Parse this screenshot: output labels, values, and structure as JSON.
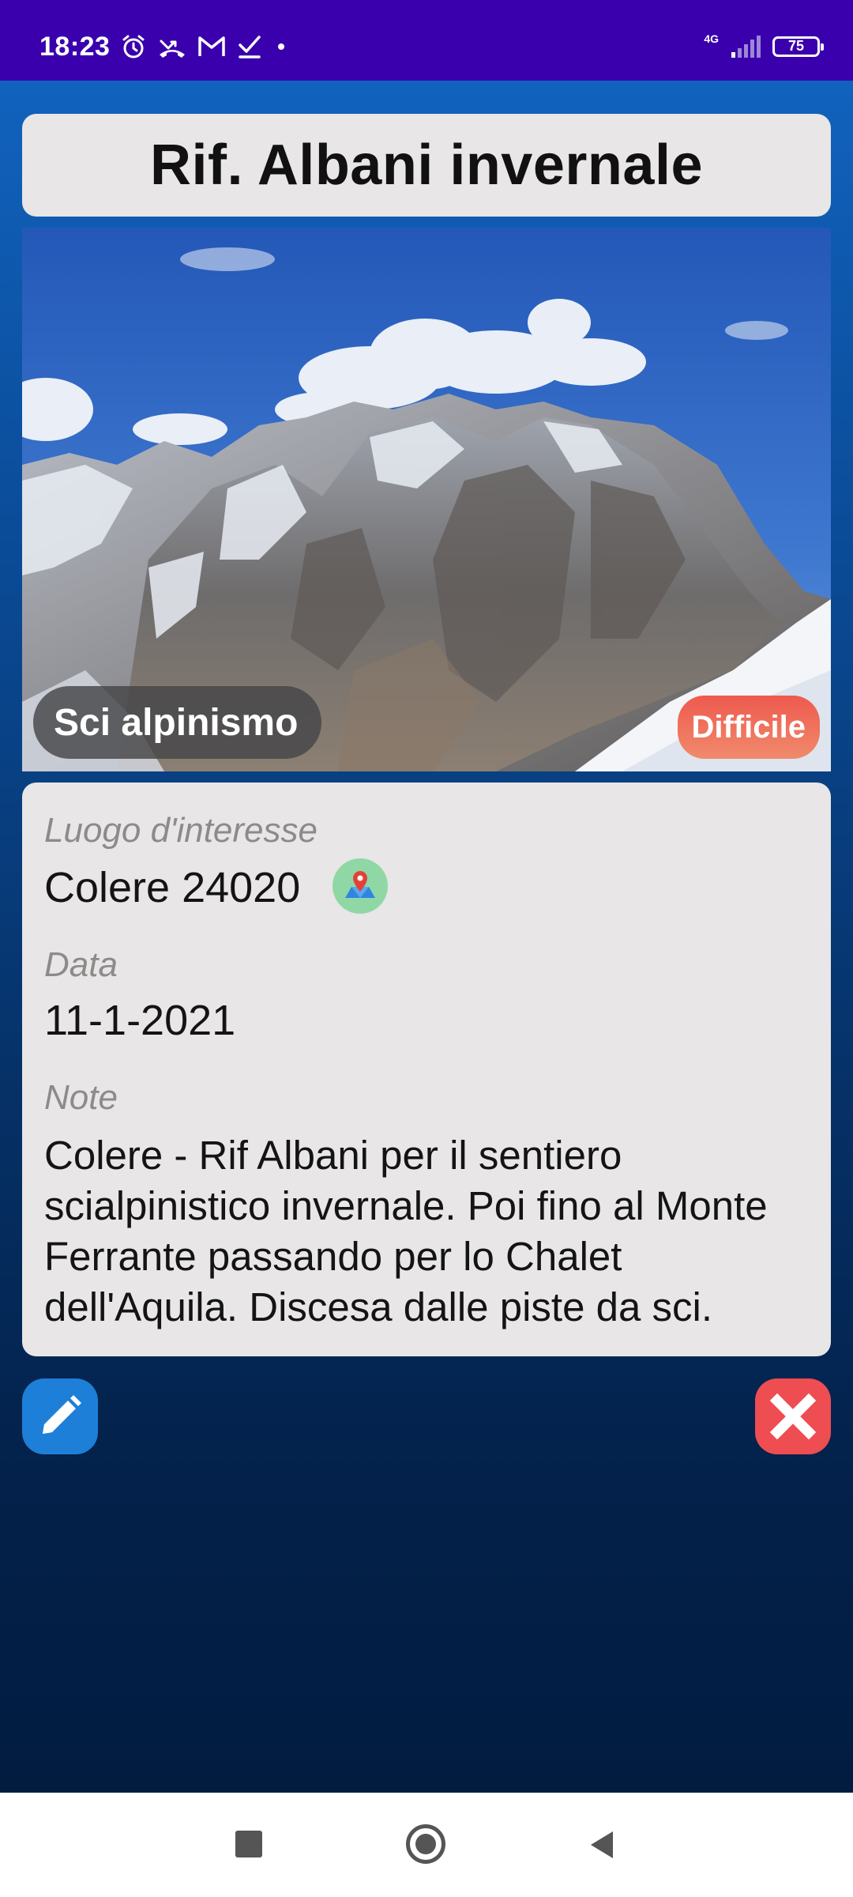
{
  "status_bar": {
    "time": "18:23",
    "network": "4G",
    "battery": "75",
    "left_icons": [
      "alarm-icon",
      "missed-call-icon",
      "gmail-icon",
      "task-done-icon",
      "dot-icon"
    ]
  },
  "excursion": {
    "title": "Rif. Albani invernale",
    "category": "Sci alpinismo",
    "difficulty": "Difficile"
  },
  "details": {
    "location_label": "Luogo d'interesse",
    "location_value": "Colere 24020",
    "date_label": "Data",
    "date_value": "11-1-2021",
    "notes_label": "Note",
    "notes_value": "Colere - Rif Albani per il sentiero scialpinistico invernale. Poi fino al Monte Ferrante passando per lo Chalet dell'Aquila. Discesa dalle piste da sci."
  },
  "actions": {
    "edit_icon": "pencil-icon",
    "delete_icon": "close-icon"
  },
  "colors": {
    "status_bar": "#3a00ad",
    "card_bg": "#e8e6e6",
    "edit_button": "#1d7fd8",
    "delete_button": "#ee4d52",
    "difficulty_badge": "#ee5a4e"
  }
}
